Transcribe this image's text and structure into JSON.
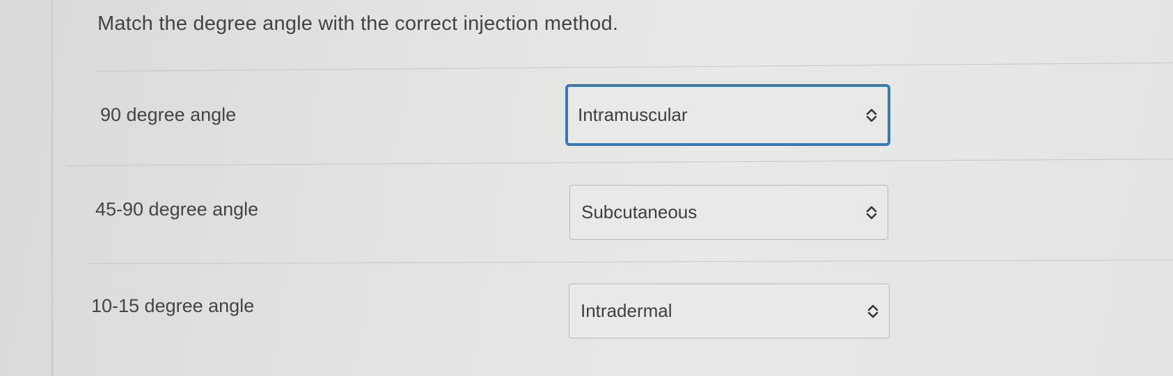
{
  "question": "Match the degree angle with the correct injection method.",
  "rows": [
    {
      "label": "90 degree angle",
      "selected": "Intramuscular",
      "focused": true
    },
    {
      "label": "45-90 degree angle",
      "selected": "Subcutaneous",
      "focused": false
    },
    {
      "label": "10-15 degree angle",
      "selected": "Intradermal",
      "focused": false
    }
  ],
  "colors": {
    "focus_border": "#3a78b4",
    "background": "#e3e3e1"
  },
  "icons": {
    "select_chevron": "chevron-up-down-icon"
  }
}
